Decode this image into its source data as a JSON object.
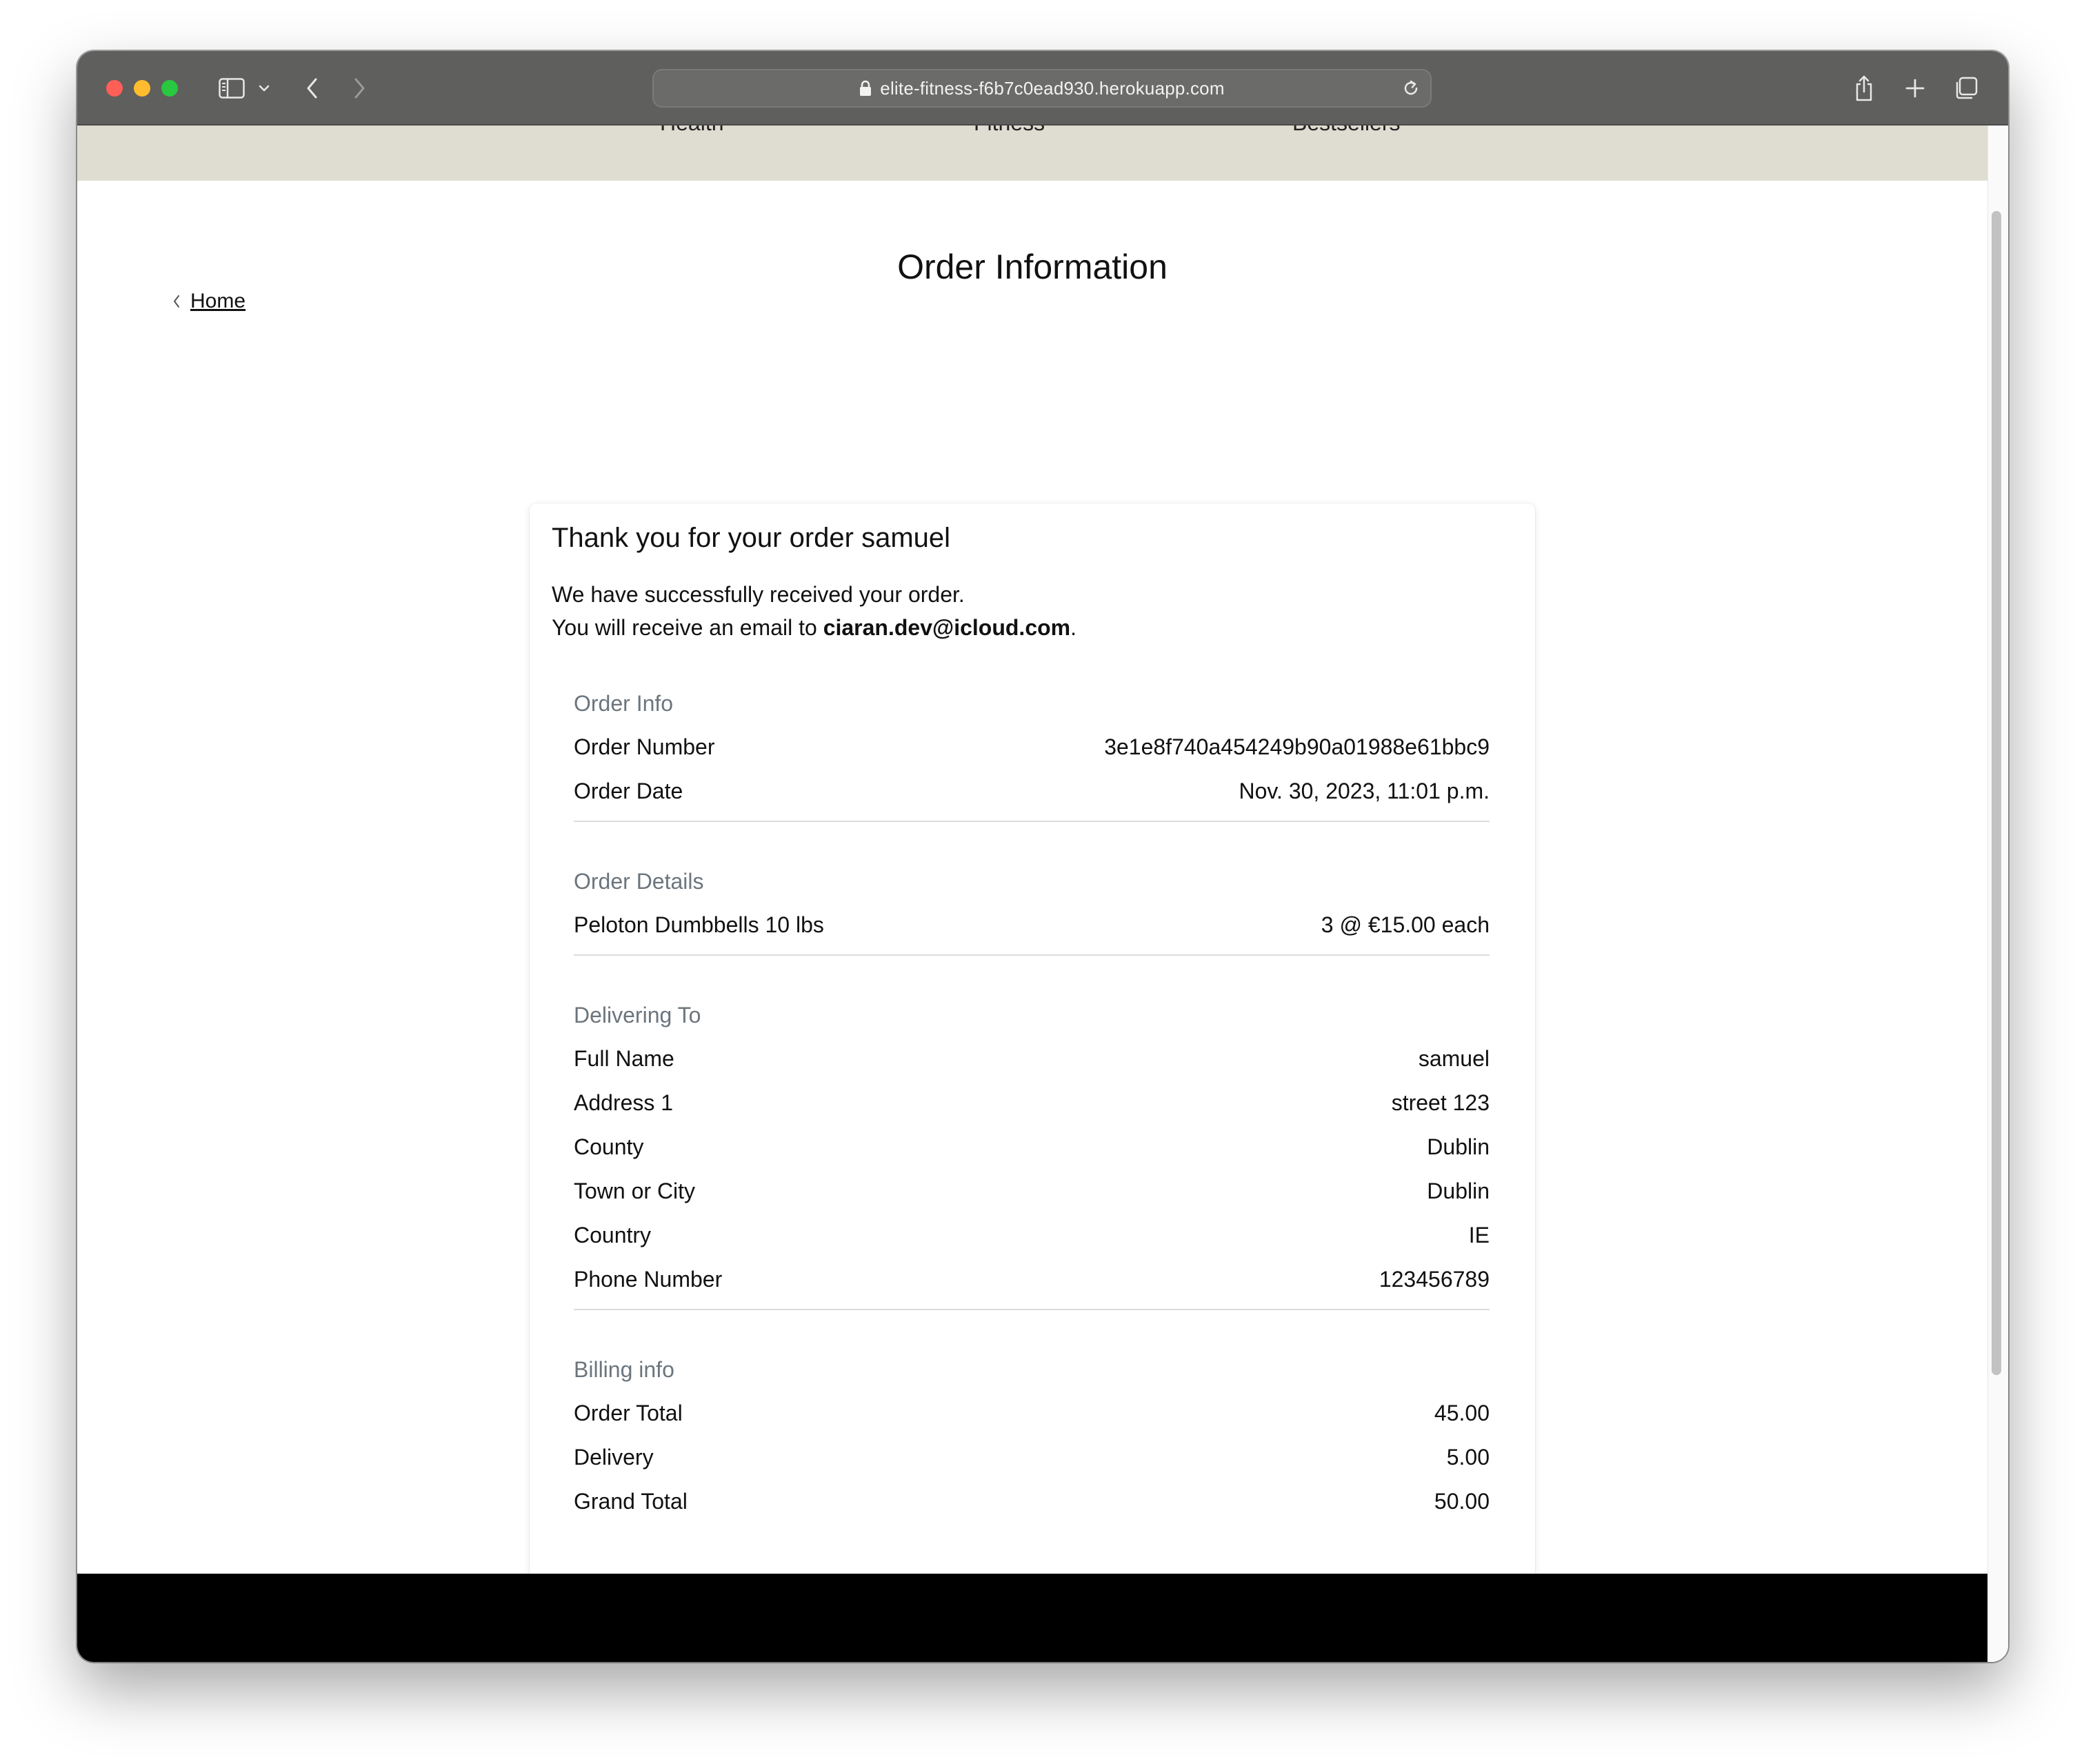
{
  "browser": {
    "url": "elite-fitness-f6b7c0ead930.herokuapp.com"
  },
  "nav": {
    "items": [
      "Health",
      "Fitness",
      "Bestsellers"
    ]
  },
  "page": {
    "title": "Order Information",
    "back_link": "Home"
  },
  "card": {
    "title": "Thank you for your order samuel",
    "message_line1": "We have successfully received your order.",
    "message_line2_prefix": "You will receive an email to ",
    "email": "ciaran.dev@icloud.com",
    "message_line2_suffix": "."
  },
  "order_info": {
    "heading": "Order Info",
    "rows": [
      {
        "label": "Order Number",
        "value": "3e1e8f740a454249b90a01988e61bbc9"
      },
      {
        "label": "Order Date",
        "value": "Nov. 30, 2023, 11:01 p.m."
      }
    ]
  },
  "order_details": {
    "heading": "Order Details",
    "rows": [
      {
        "label": "Peloton Dumbbells 10 lbs",
        "value": "3 @ €15.00 each"
      }
    ]
  },
  "delivering_to": {
    "heading": "Delivering To",
    "rows": [
      {
        "label": "Full Name",
        "value": "samuel"
      },
      {
        "label": "Address 1",
        "value": "street 123"
      },
      {
        "label": "County",
        "value": "Dublin"
      },
      {
        "label": "Town or City",
        "value": "Dublin"
      },
      {
        "label": "Country",
        "value": "IE"
      },
      {
        "label": "Phone Number",
        "value": "123456789"
      }
    ]
  },
  "billing_info": {
    "heading": "Billing info",
    "rows": [
      {
        "label": "Order Total",
        "value": "45.00"
      },
      {
        "label": "Delivery",
        "value": "5.00"
      },
      {
        "label": "Grand Total",
        "value": "50.00"
      }
    ]
  },
  "icons": {
    "sidebar": "sidebar-icon",
    "back": "chevron-left-icon",
    "forward": "chevron-right-icon",
    "lock": "lock-icon",
    "reload": "reload-icon",
    "share": "share-icon",
    "new_tab": "plus-icon",
    "tabs": "tabs-overview-icon"
  },
  "colors": {
    "titlebar": "#5f5f5d",
    "nav_strip": "#dfdcd1",
    "section_heading": "#6c757d",
    "footer": "#000000"
  }
}
